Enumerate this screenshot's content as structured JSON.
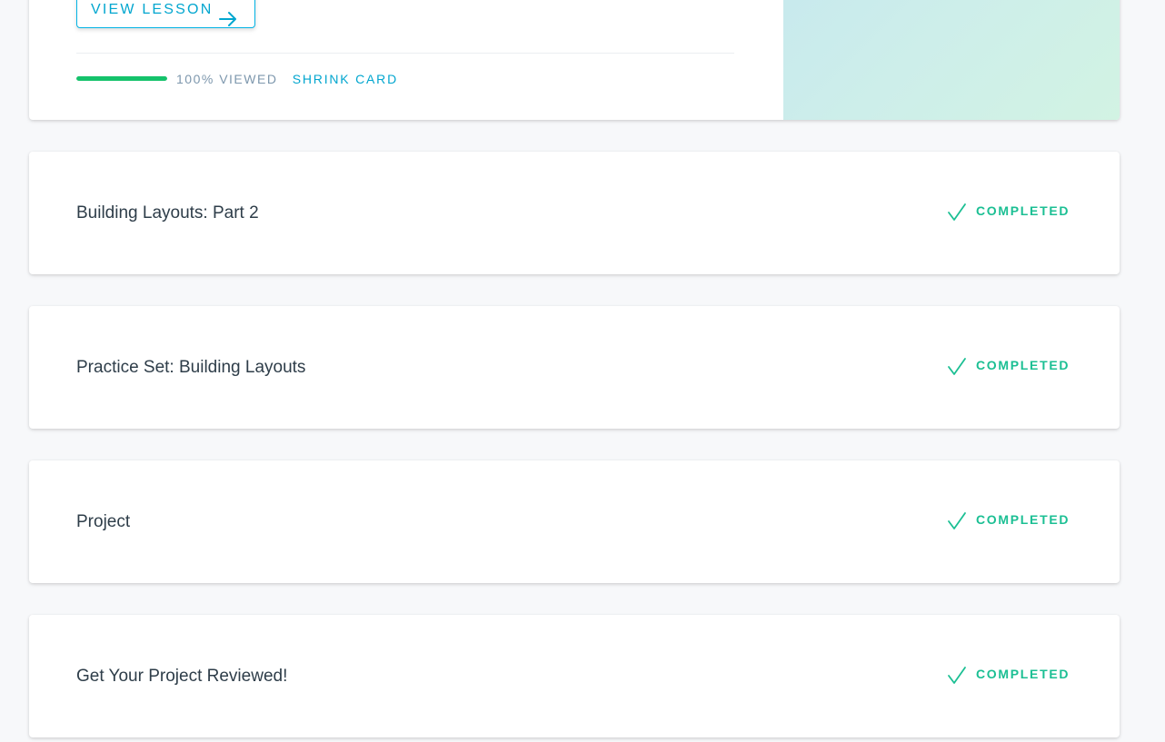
{
  "expanded_card": {
    "view_lesson_label": "VIEW LESSON",
    "progress_percent": 100,
    "viewed_label": "100% VIEWED",
    "shrink_label": "SHRINK CARD",
    "progress_color": "#15c26b",
    "accent_color": "#02b3e4"
  },
  "lessons": [
    {
      "title": "Building Layouts: Part 2",
      "status": "COMPLETED",
      "status_icon": "check-icon"
    },
    {
      "title": "Practice Set: Building Layouts",
      "status": "COMPLETED",
      "status_icon": "check-icon"
    },
    {
      "title": "Project",
      "status": "COMPLETED",
      "status_icon": "check-icon"
    },
    {
      "title": "Get Your Project Reviewed!",
      "status": "COMPLETED",
      "status_icon": "check-icon"
    }
  ]
}
